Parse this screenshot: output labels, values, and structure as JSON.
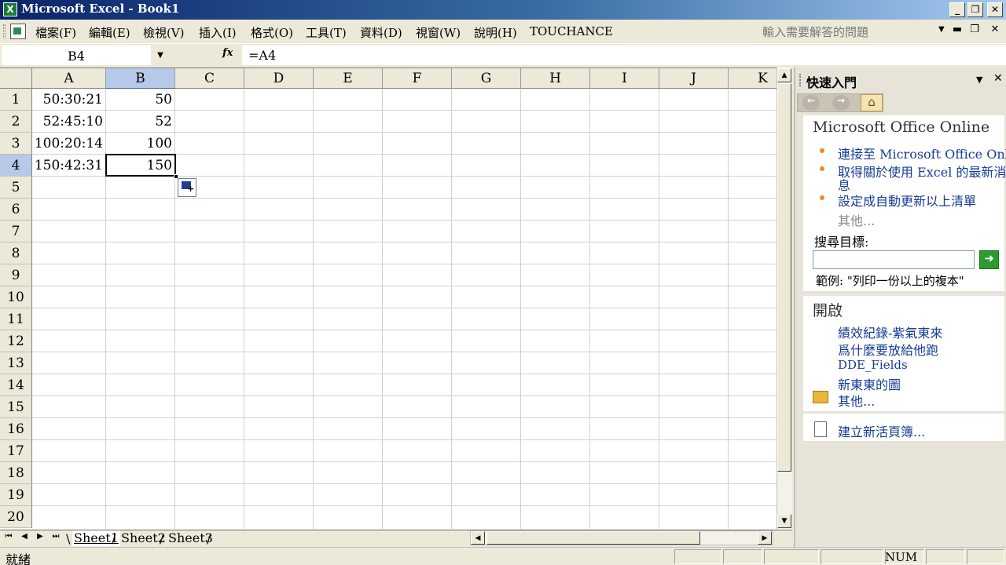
{
  "window": {
    "title": "Microsoft Excel - Book1",
    "app_icon": "excel-icon",
    "buttons": {
      "minimize": "_",
      "restore": "❐",
      "close": "✕"
    }
  },
  "menubar": {
    "items": [
      "檔案(F)",
      "編輯(E)",
      "檢視(V)",
      "插入(I)",
      "格式(O)",
      "工具(T)",
      "資料(D)",
      "視窗(W)",
      "說明(H)",
      "TOUCHANCE"
    ],
    "help_placeholder": "輸入需要解答的問題",
    "mdi_buttons": {
      "minimize": "▬",
      "restore": "❐",
      "close": "✕"
    }
  },
  "formula_bar": {
    "name_box": "B4",
    "fx_label": "fx",
    "formula": "=A4"
  },
  "grid": {
    "columns": [
      "A",
      "B",
      "C",
      "D",
      "E",
      "F",
      "G",
      "H",
      "I",
      "J",
      "K"
    ],
    "selected_column": "B",
    "rows": [
      "1",
      "2",
      "3",
      "4",
      "5",
      "6",
      "7",
      "8",
      "9",
      "10",
      "11",
      "12",
      "13",
      "14",
      "15",
      "16",
      "17",
      "18",
      "19",
      "20"
    ],
    "cells": [
      {
        "A": "50:30:21",
        "B": "50"
      },
      {
        "A": "52:45:10",
        "B": "52"
      },
      {
        "A": "100:20:14",
        "B": "100"
      },
      {
        "A": "150:42:31",
        "B": "150"
      }
    ],
    "active_cell": "B4"
  },
  "sheet_tabs": {
    "tabs": [
      "Sheet1",
      "Sheet2",
      "Sheet3"
    ],
    "active": "Sheet1"
  },
  "status_bar": {
    "text": "就緒",
    "num": "NUM"
  },
  "task_pane": {
    "title": "快速入門",
    "online_section": {
      "title": "Microsoft Office Online",
      "links": [
        "連接至 Microsoft Office Online",
        "取得關於使用 Excel 的最新消",
        "息",
        "設定成自動更新以上清單"
      ],
      "more": "其他...",
      "search_label": "搜尋目標:",
      "search_value": "",
      "example": "範例: \"列印一份以上的複本\""
    },
    "open_section": {
      "title": "開啟",
      "files": [
        "績效紀錄-紫氣東來",
        "爲什麼要放給他跑",
        "DDE_Fields",
        "新東東的圖"
      ],
      "more": "其他...",
      "new_workbook": "建立新活頁簿..."
    }
  }
}
